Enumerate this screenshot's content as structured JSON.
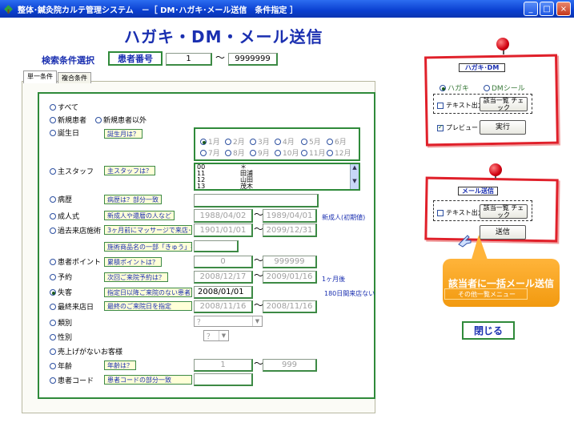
{
  "window": {
    "title": "整体･鍼灸院カルテ管理システム　－［ DM･ハガキ･メール送信　条件指定 ］",
    "minimize": "_",
    "maximize": "□",
    "close": "×"
  },
  "header": {
    "title": "ハガキ・DM・メール送信"
  },
  "search": {
    "label": "検索条件選択",
    "key_label": "患者番号",
    "from": "1",
    "tilde": "～",
    "to": "9999999"
  },
  "tabs": [
    {
      "label": "単一条件"
    },
    {
      "label": "複合条件"
    }
  ],
  "conditions": {
    "all": "すべて",
    "new_patient": "新規患者",
    "not_new_patient": "新規患者以外",
    "birthday": {
      "label": "誕生日",
      "hint": "誕生月は？",
      "months": [
        "1月",
        "2月",
        "3月",
        "4月",
        "5月",
        "6月",
        "7月",
        "8月",
        "9月",
        "10月",
        "11月",
        "12月"
      ]
    },
    "staff": {
      "label": "主スタッフ",
      "hint": "主スタッフは？",
      "rows": [
        [
          "00",
          "＊"
        ],
        [
          "11",
          "田浦"
        ],
        [
          "12",
          "山田"
        ],
        [
          "13",
          "茂木"
        ]
      ]
    },
    "history": {
      "label": "病歴",
      "hint": "病歴は？部分一致"
    },
    "coming_of_age": {
      "label": "成人式",
      "hint": "新成人や還暦の人など",
      "from": "1988/04/02",
      "to": "1989/04/01",
      "note": "新成人(初期値)"
    },
    "past_treatment": {
      "label": "過去来店施術",
      "hint": "3ヶ月前にマッサージで来店･･",
      "from": "1901/01/01",
      "to": "2099/12/31",
      "hint2": "施術商品名の一部「きゅう」等"
    },
    "points": {
      "label": "患者ポイント",
      "hint": "累積ポイントは？",
      "from": "0",
      "to": "999999"
    },
    "appointment": {
      "label": "予約",
      "hint": "次回ご来院予約は？",
      "from": "2008/12/17",
      "to": "2009/01/16",
      "note": "1ヶ月後"
    },
    "lost": {
      "label": "失客",
      "hint": "指定日以降ご来院のない患者",
      "from": "2008/01/01",
      "note": "180日間来店ない"
    },
    "last_visit": {
      "label": "最終来店日",
      "hint": "最終のご来院日を指定",
      "from": "2008/11/16",
      "to": "2008/11/16"
    },
    "category": {
      "label": "類別",
      "value": "？"
    },
    "gender": {
      "label": "性別",
      "value": "？"
    },
    "no_sales": {
      "label": "売上げがないお客様"
    },
    "age": {
      "label": "年齢",
      "hint": "年齢は？",
      "from": "1",
      "to": "999"
    },
    "patient_code": {
      "label": "患者コード",
      "hint": "患者コードの部分一致"
    }
  },
  "postcard_panel": {
    "title": "ハガキ･DM",
    "opt_postcard": "ハガキ",
    "opt_dm": "DMシール",
    "text_output": "テキスト出力",
    "check_list": "該当一覧 チェック",
    "preview": "プレビュー",
    "run": "実行"
  },
  "mail_panel": {
    "title": "メール送信",
    "text_output": "テキスト出力",
    "check_list": "該当一覧 チェック",
    "send": "送信",
    "callout": "該当者に一括メール送信",
    "hidden_menu": "その他一覧メニュー"
  },
  "close_button": "閉じる",
  "colors": {
    "title_blue": "#1a2fb0",
    "border_green": "#2f8a3a",
    "note_red": "#e0202a",
    "callout_orange": "#f29a10"
  }
}
